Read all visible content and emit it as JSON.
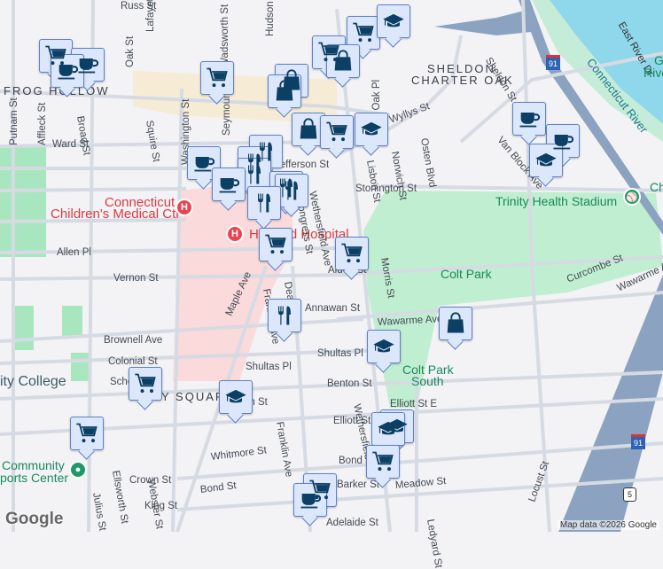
{
  "neighborhoods": [
    "FROG HOLLOW",
    "SHELDON",
    "CHARTER OAK",
    "Y SQUAR"
  ],
  "pois": {
    "ccmc_1": "Connecticut",
    "ccmc_2": "Children's Medical Ctr",
    "hospital": "Hartford Hospital",
    "stadium": "Trinity Health Stadium",
    "colt_park": "Colt Park",
    "colt_south_1": "Colt Park",
    "colt_south_2": "South",
    "college": "ity College",
    "community_1": "Community",
    "community_2": "ports Center",
    "river": "Connecticut River",
    "east_river": "East River Dr",
    "gr_1": "G",
    "gr_2": "Rive",
    "ch": "Ch"
  },
  "streets": {
    "russ": "Russ St",
    "lafayette": "Lafayette St",
    "hudson": "Hudson St",
    "wadsworth": "Wadsworth St",
    "oak": "Oak St",
    "putnam": "Putnam St",
    "affleck": "Affleck St",
    "broad": "Broad St",
    "squire": "Squire St",
    "washington": "Washington St",
    "seymour": "Seymour St",
    "ward": "Ward St",
    "jefferson": "Jefferson St",
    "congress": "Congress St",
    "allen": "Allen Pl",
    "vernon": "Vernon St",
    "dean": "Dean St",
    "alden": "Alden St",
    "annawan": "Annawan St",
    "brownell": "Brownell Ave",
    "colonial": "Colonial St",
    "shultas": "Shultas Pl",
    "benton": "Benton St",
    "maple": "Maple Ave",
    "franklin": "Franklin Ave",
    "franklin2": "Franklin Ave",
    "webster": "Webster St",
    "ellsworth": "Ellsworth St",
    "julius": "Julius St",
    "whitmore": "Whitmore St",
    "crown": "Crown St",
    "bond": "Bond St",
    "king": "King St",
    "elliott": "Elliott St",
    "elliott_e": "Elliott St E",
    "barker": "Barker St",
    "meadow": "Meadow St",
    "adelaide": "Adelaide St",
    "ledyard": "Ledyard St",
    "locust": "Locust St",
    "wawarme": "Wawarme Ave",
    "wawarme2": "Wawarme Ave",
    "curcombe": "Curcombe St",
    "morris": "Morris St",
    "stonington": "Stonington St",
    "wethersfield": "Wethersfield Ave",
    "wethersfield2": "Wethersfield",
    "lisbon": "Lisbon St",
    "norwich": "Norwich St",
    "osten": "Osten Blvd",
    "nyllys": "Wyllys St",
    "charter_oak_pl": "Charter Oak Pl",
    "sheldon": "Sheldon St",
    "van_block": "Van Block Ave",
    "school": "School St",
    "ash": "Ash St",
    "madison": "Madison St"
  },
  "shields": {
    "i91_a": "91",
    "i91_b": "91",
    "us5": "5"
  },
  "markers": [
    "shopping-cart",
    "coffee-cup",
    "graduation-cap",
    "shopping-bag",
    "restaurant"
  ],
  "colors": {
    "marker_fill": "#dde7fb",
    "marker_border": "#5a82c9",
    "icon": "#0b3f63",
    "park": "#bfeed0",
    "hospital_area": "#fadada",
    "river": "#8fd7ea",
    "highway": "#8ba2c0"
  },
  "footer": {
    "logo": "Google",
    "attribution": "Map data ©2026 Google"
  }
}
